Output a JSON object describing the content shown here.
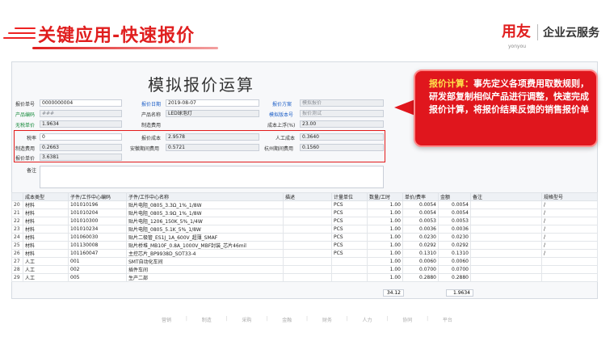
{
  "header": {
    "title": "关键应用-快速报价",
    "brand_logo": "用友",
    "brand_sub": "yonyou",
    "brand_name": "企业云服务"
  },
  "form": {
    "title": "模拟报价运算",
    "fields": {
      "quote_no_label": "报价单号",
      "quote_no": "0000000004",
      "quote_date_label": "报价日期",
      "quote_date": "2019-08-07",
      "scheme_label": "报价方案",
      "scheme": "模拟报价",
      "product_code_label": "产品编码",
      "product_code": "###",
      "product_name_label": "产品名称",
      "product_name": "LED球泡灯",
      "template_label": "模拟版本号",
      "template": "报价测试",
      "nontax_price_label": "无税单价",
      "nontax_price": "1.9634",
      "mfg_cost_label": "制造费用",
      "cost_rate_label": "成本上浮(%)",
      "cost_rate": "23.00",
      "tax_rate_label": "税率",
      "tax_rate": "0",
      "quote_cost_label": "报价成本",
      "quote_cost": "2.9578",
      "labor_cost_label": "人工成本",
      "labor_cost": "0.3640",
      "mfg_fee_label": "制造费用",
      "mfg_fee": "0.2663",
      "install_fee_label": "安徽期间费用",
      "install_fee": "0.5721",
      "hangzhou_fee_label": "杭州期间费用",
      "hangzhou_fee": "0.1560",
      "quote_price_label": "报价单价",
      "quote_price": "3.6381",
      "notes_label": "备注"
    }
  },
  "callout": {
    "heading": "报价计算：",
    "body": "事先定义各项费用取数规则，研发部复制相似产品进行调整，快速完成报价计算，将报价结果反馈的销售报价单"
  },
  "table": {
    "headers": [
      "",
      "成本类型",
      "子件/工作中心编码",
      "子件/工作中心名称",
      "描述",
      "计量单位",
      "数量/工时",
      "单价/费率",
      "金额",
      "备注",
      "规格型号"
    ],
    "rows": [
      [
        "20",
        "材料",
        "101010196",
        "贴片电阻_0805_3.3Ω_1%_1/8W",
        "",
        "PCS",
        "1.00",
        "0.0054",
        "0.0054",
        "",
        "/"
      ],
      [
        "21",
        "材料",
        "101010204",
        "贴片电阻_0805_3.9Ω_1%_1/8W",
        "",
        "PCS",
        "1.00",
        "0.0054",
        "0.0054",
        "",
        "/"
      ],
      [
        "22",
        "材料",
        "101010300",
        "贴片电阻_1206_150K_5%_1/4W",
        "",
        "PCS",
        "1.00",
        "0.0053",
        "0.0053",
        "",
        "/"
      ],
      [
        "23",
        "材料",
        "101010234",
        "贴片电阻_0805_5.1K_5%_1/8W",
        "",
        "PCS",
        "1.00",
        "0.0036",
        "0.0036",
        "",
        "/"
      ],
      [
        "24",
        "材料",
        "101060030",
        "贴片二极管_ES1J_1A_600V_超薄_SMAF",
        "",
        "PCS",
        "1.00",
        "0.0230",
        "0.0230",
        "",
        "/"
      ],
      [
        "25",
        "材料",
        "101130008",
        "贴片桥堆_MB10F_0.8A_1000V_MBF封装_芯片46mil",
        "",
        "PCS",
        "1.00",
        "0.0292",
        "0.0292",
        "",
        "/"
      ],
      [
        "26",
        "材料",
        "101160047",
        "主控芯片_BP9938D_SOT33-4",
        "",
        "PCS",
        "1.00",
        "0.1310",
        "0.1310",
        "",
        "/"
      ],
      [
        "27",
        "人工",
        "001",
        "SMT自动化车间",
        "",
        "",
        "1.00",
        "0.0060",
        "0.0060",
        "",
        ""
      ],
      [
        "28",
        "人工",
        "002",
        "插件车间",
        "",
        "",
        "1.00",
        "0.0700",
        "0.0700",
        "",
        ""
      ],
      [
        "29",
        "人工",
        "005",
        "生产二部",
        "",
        "",
        "1.00",
        "0.2880",
        "0.2880",
        "",
        ""
      ]
    ],
    "total_qty": "34.12",
    "total_amount": "1.9634"
  },
  "footer": {
    "items": [
      "营销",
      "制造",
      "采购",
      "金融",
      "财务",
      "人力",
      "协同",
      "平台"
    ]
  }
}
